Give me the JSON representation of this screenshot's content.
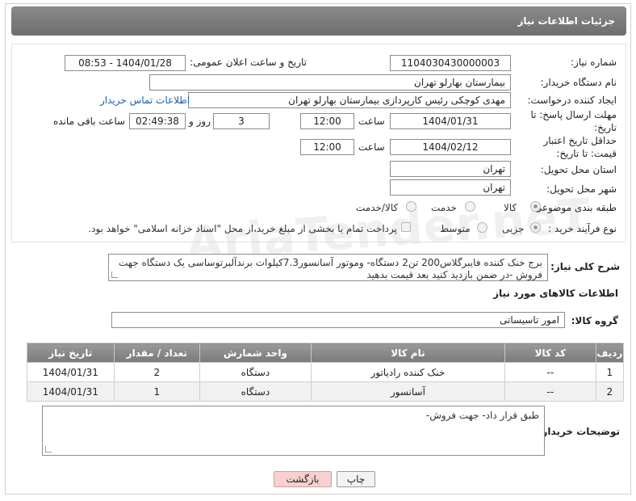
{
  "header": {
    "title": "جزئیات اطلاعات نیاز"
  },
  "form": {
    "need_number_label": "شماره نیاز:",
    "need_number": "1104030430000003",
    "announce_label": "تاریخ و ساعت اعلان عمومی:",
    "announce_value": "1404/01/28 - 08:53",
    "buyer_org_label": "نام دستگاه خریدار:",
    "buyer_org": "بیمارستان بهارلو تهران",
    "creator_label": "ایجاد کننده درخواست:",
    "creator": "مهدی کوچکی  رئیس کارپردازی بیمارستان بهارلو تهران",
    "contact_link": "اطلاعات تماس خریدار",
    "deadline_label": "مهلت ارسال پاسخ: تا تاریخ:",
    "deadline_date": "1404/01/31",
    "time_label": "ساعت",
    "deadline_time": "12:00",
    "days_value": "3",
    "days_label": "روز و",
    "remaining_time": "02:49:38",
    "remaining_label": "ساعت باقی مانده",
    "validity_label": "حداقل تاریخ اعتبار قیمت: تا تاریخ:",
    "validity_date": "1404/02/12",
    "validity_time": "12:00",
    "province_label": "استان محل تحویل:",
    "province": "تهران",
    "city_label": "شهر محل تحویل:",
    "city": "تهران",
    "category_label": "طبقه بندی موضوعی:",
    "category_options": [
      "کالا",
      "خدمت",
      "کالا/خدمت"
    ],
    "process_label": "نوع فرآیند خرید :",
    "process_options": [
      "جزیی",
      "متوسط"
    ],
    "payment_note": "پرداخت تمام یا بخشی از مبلغ خرید،از محل \"اسناد خزانه اسلامی\" خواهد بود."
  },
  "summary": {
    "label": "شرح کلی نیاز:",
    "text": "برج خنک کننده فایبرگلاس200 تن2 دستگاه- وموتور آسانسور7.3کیلوات برندآلبرتوساسی یک دستگاه جهت فروش -در ضمن بازدید کنید بعد قیمت بدهید"
  },
  "goods": {
    "section_title": "اطلاعات کالاهای مورد نیاز",
    "group_label": "گروه کالا:",
    "group_value": "امور تاسیساتی",
    "columns": [
      "ردیف",
      "کد کالا",
      "نام کالا",
      "واحد شمارش",
      "تعداد / مقدار",
      "تاریخ نیاز"
    ],
    "rows": [
      [
        "1",
        "--",
        "خنک کننده رادیاتور",
        "دستگاه",
        "2",
        "1404/01/31"
      ],
      [
        "2",
        "--",
        "آسانسور",
        "دستگاه",
        "1",
        "1404/01/31"
      ]
    ]
  },
  "notes": {
    "label": "توضیحات خریدار:",
    "text": "طبق قرار داد- جهت فروش-"
  },
  "buttons": {
    "print": "چاپ",
    "back": "بازگشت"
  },
  "watermark": "AriaTender.neT"
}
